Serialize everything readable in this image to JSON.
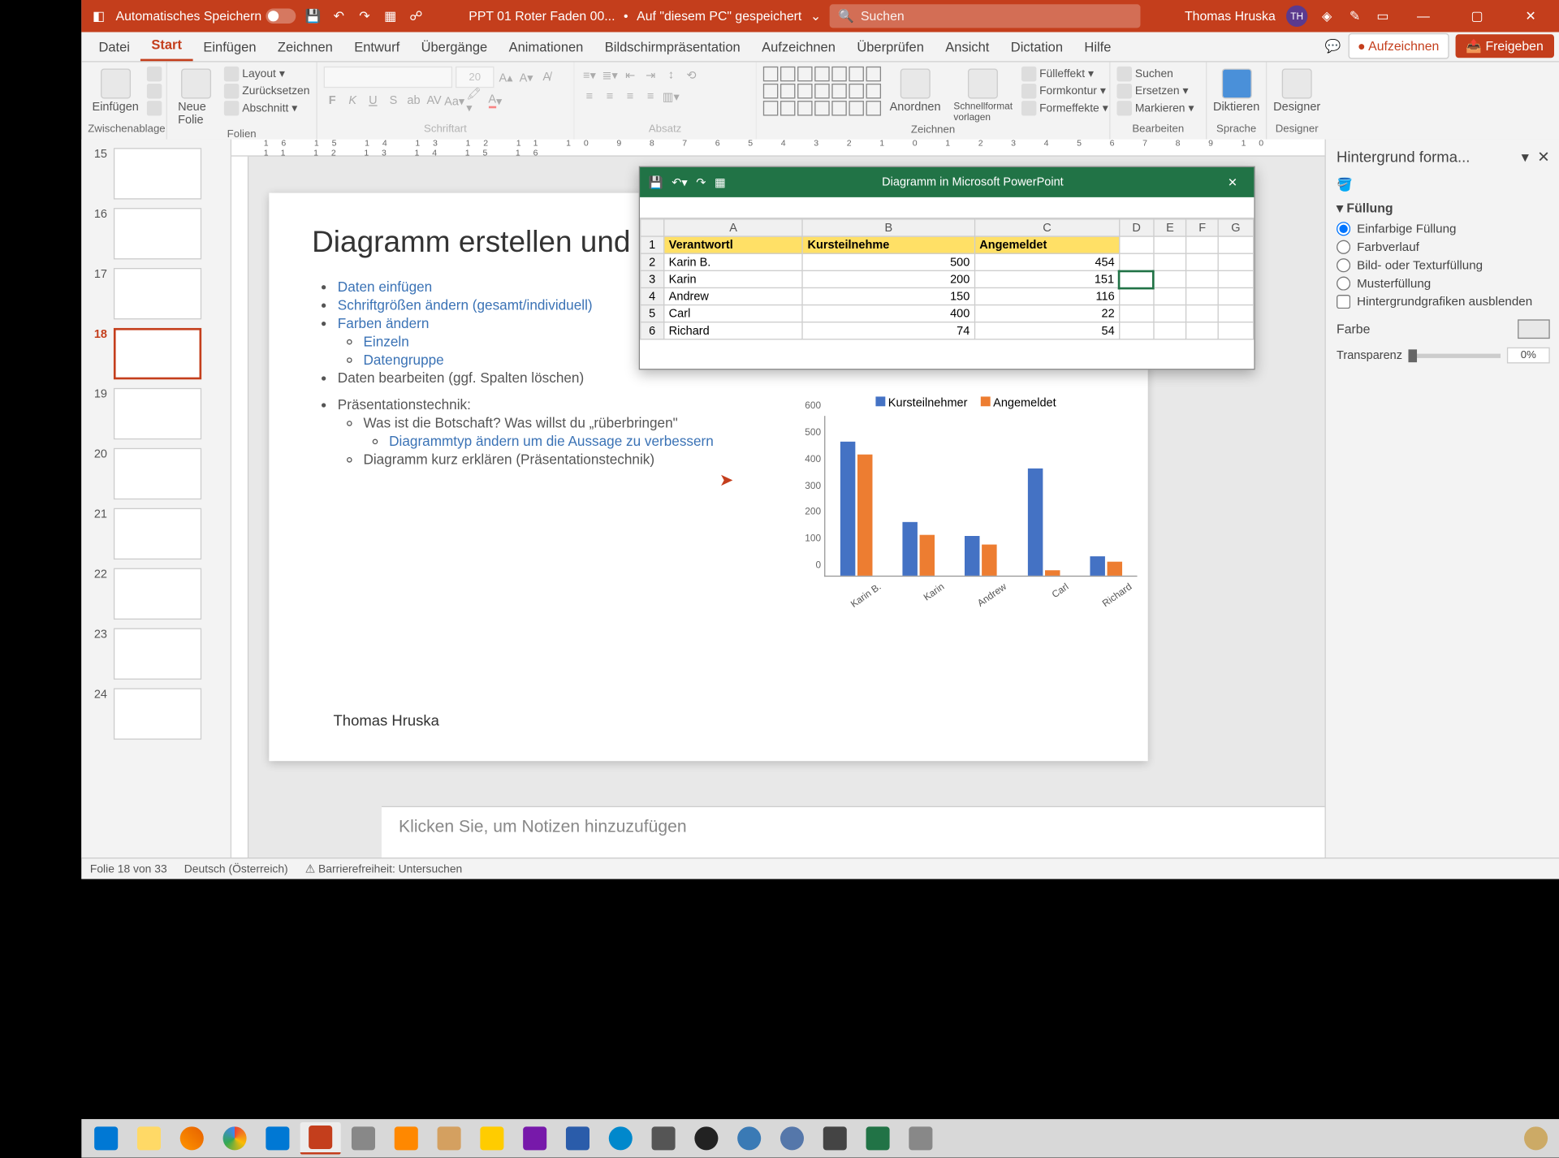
{
  "titlebar": {
    "autosave_label": "Automatisches Speichern",
    "filename": "PPT 01 Roter Faden 00...",
    "saved_location": "Auf \"diesem PC\" gespeichert",
    "search_placeholder": "Suchen",
    "user_name": "Thomas Hruska",
    "user_initials": "TH"
  },
  "tabs": {
    "items": [
      "Datei",
      "Start",
      "Einfügen",
      "Zeichnen",
      "Entwurf",
      "Übergänge",
      "Animationen",
      "Bildschirmpräsentation",
      "Aufzeichnen",
      "Überprüfen",
      "Ansicht",
      "Dictation",
      "Hilfe"
    ],
    "active_index": 1,
    "record_btn": "Aufzeichnen",
    "share_btn": "Freigeben"
  },
  "ribbon": {
    "clipboard": {
      "paste": "Einfügen",
      "label": "Zwischenablage"
    },
    "slides": {
      "new_slide": "Neue Folie",
      "layout": "Layout",
      "reset": "Zurücksetzen",
      "section": "Abschnitt",
      "label": "Folien"
    },
    "font": {
      "size": "20",
      "label": "Schriftart"
    },
    "paragraph": {
      "label": "Absatz"
    },
    "drawing": {
      "arrange": "Anordnen",
      "quickstyles": "Schnellformat vorlagen",
      "fill": "Fülleffekt",
      "outline": "Formkontur",
      "effects": "Formeffekte",
      "label": "Zeichnen"
    },
    "editing": {
      "find": "Suchen",
      "replace": "Ersetzen",
      "select": "Markieren",
      "label": "Bearbeiten"
    },
    "voice": {
      "dictate": "Diktieren",
      "label": "Sprache"
    },
    "designer": {
      "designer": "Designer",
      "label": "Designer"
    }
  },
  "thumbs": {
    "visible": [
      15,
      16,
      17,
      18,
      19,
      20,
      21,
      22,
      23,
      24
    ],
    "selected": 18
  },
  "slide": {
    "title": "Diagramm erstellen und formatieren",
    "bullets": {
      "b1": "Daten einfügen",
      "b2": "Schriftgrößen ändern (gesamt/individuell)",
      "b3": "Farben ändern",
      "b3a": "Einzeln",
      "b3b": "Datengruppe",
      "b4": "Daten bearbeiten (ggf. Spalten löschen)",
      "b5": "Präsentationstechnik:",
      "b5a": "Was ist die Botschaft? Was willst du „rüberbringen\"",
      "b5a1": "Diagrammtyp ändern um die Aussage zu verbessern",
      "b5b": "Diagramm kurz erklären (Präsentationstechnik)"
    },
    "author": "Thomas Hruska"
  },
  "chart_data": {
    "type": "bar",
    "categories": [
      "Karin B.",
      "Karin",
      "Andrew",
      "Carl",
      "Richard"
    ],
    "series": [
      {
        "name": "Kursteilnehmer",
        "values": [
          500,
          200,
          150,
          400,
          74
        ],
        "color": "#4472c4"
      },
      {
        "name": "Angemeldet",
        "values": [
          454,
          151,
          116,
          22,
          54
        ],
        "color": "#ed7d31"
      }
    ],
    "ylim": [
      0,
      600
    ],
    "yticks": [
      0,
      100,
      200,
      300,
      400,
      500,
      600
    ]
  },
  "data_window": {
    "title": "Diagramm in Microsoft PowerPoint",
    "columns": [
      "A",
      "B",
      "C",
      "D",
      "E",
      "F",
      "G"
    ],
    "header_row": [
      "Verantwortl",
      "Kursteilnehme",
      "Angemeldet"
    ],
    "rows": [
      [
        "Karin B.",
        "500",
        "454"
      ],
      [
        "Karin",
        "200",
        "151"
      ],
      [
        "Andrew",
        "150",
        "116"
      ],
      [
        "Carl",
        "400",
        "22"
      ],
      [
        "Richard",
        "74",
        "54"
      ]
    ],
    "selected_cell": "D3"
  },
  "format_pane": {
    "title": "Hintergrund forma...",
    "section": "Füllung",
    "options": [
      "Einfarbige Füllung",
      "Farbverlauf",
      "Bild- oder Texturfüllung",
      "Musterfüllung",
      "Hintergrundgrafiken ausblenden"
    ],
    "selected_option": 0,
    "color_label": "Farbe",
    "transparency_label": "Transparenz",
    "transparency_value": "0%"
  },
  "notes": {
    "placeholder": "Klicken Sie, um Notizen hinzuzufügen"
  },
  "statusbar": {
    "slide_info": "Folie 18 von 33",
    "language": "Deutsch (Österreich)",
    "accessibility": "Barrierefreiheit: Untersuchen"
  },
  "ruler": "16  15  14  13  12  11  10  9  8  7  6  5  4  3  2  1  0  1  2  3  4  5  6  7  8  9  10  11  12  13  14  15  16"
}
